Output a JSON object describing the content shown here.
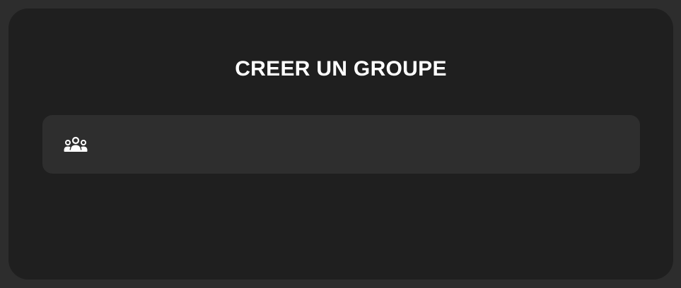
{
  "dialog": {
    "title": "CREER UN GROUPE",
    "group_name_field": {
      "value": "",
      "placeholder": "",
      "icon": "group-icon"
    }
  },
  "colors": {
    "page_background": "#2d2d2d",
    "dialog_background": "#1f1f1f",
    "field_background": "#2e2e2e",
    "text": "#ffffff"
  }
}
